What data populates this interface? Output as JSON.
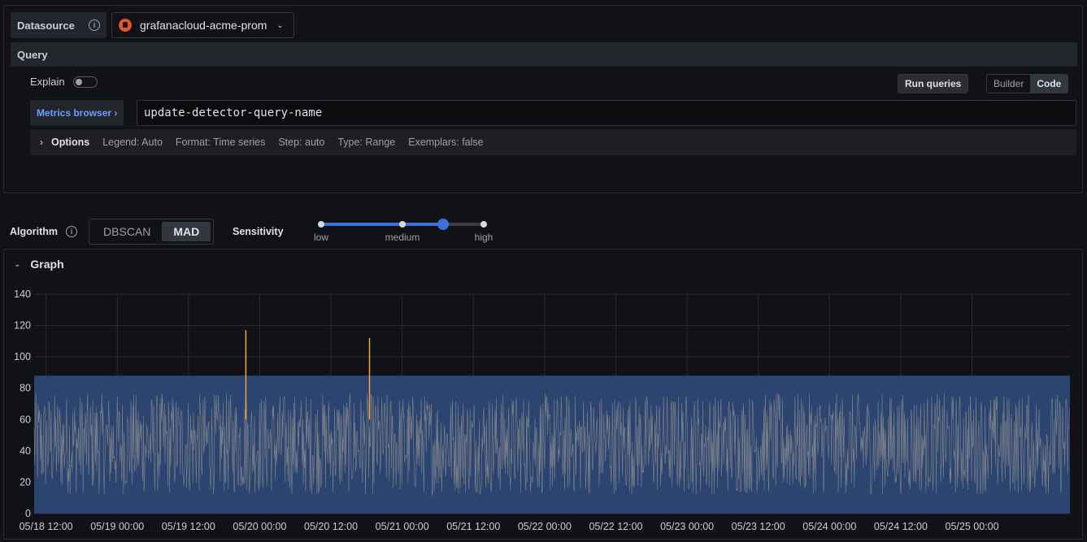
{
  "datasource": {
    "label": "Datasource",
    "icon": "prometheus-icon",
    "selected": "grafanacloud-acme-prom"
  },
  "query": {
    "section_label": "Query",
    "explain_label": "Explain",
    "explain_enabled": false,
    "run_label": "Run queries",
    "modes": [
      "Builder",
      "Code"
    ],
    "active_mode": "Code",
    "metrics_browser_label": "Metrics browser ›",
    "expression": "update-detector-query-name",
    "options": {
      "title": "Options",
      "items": [
        "Legend: Auto",
        "Format: Time series",
        "Step: auto",
        "Type: Range",
        "Exemplars: false"
      ]
    }
  },
  "algorithm": {
    "label": "Algorithm",
    "options": [
      "DBSCAN",
      "MAD"
    ],
    "selected": "MAD"
  },
  "sensitivity": {
    "label": "Sensitivity",
    "ticks": [
      "low",
      "medium",
      "high"
    ],
    "value_fraction": 0.75
  },
  "graph": {
    "title": "Graph"
  },
  "colors": {
    "series": "#8e8e8e",
    "band": "#2c4470",
    "anomaly": "#f2a73b",
    "accent": "#3d71d9"
  },
  "chart_data": {
    "type": "line",
    "title": "",
    "xlabel": "",
    "ylabel": "",
    "ylim": [
      0,
      140
    ],
    "yticks": [
      0,
      20,
      40,
      60,
      80,
      100,
      120,
      140
    ],
    "xticks": [
      "05/18 12:00",
      "05/19 00:00",
      "05/19 12:00",
      "05/20 00:00",
      "05/20 12:00",
      "05/21 00:00",
      "05/21 12:00",
      "05/22 00:00",
      "05/22 12:00",
      "05/23 00:00",
      "05/23 12:00",
      "05/24 00:00",
      "05/24 12:00",
      "05/25 00:00"
    ],
    "x_range": [
      "05/18 10:00",
      "05/25 16:30"
    ],
    "band": {
      "lower": 0,
      "upper": 88
    },
    "series_range": {
      "min": 12,
      "max": 77
    },
    "anomalies": [
      {
        "x": "05/19 21:40",
        "value": 117
      },
      {
        "x": "05/20 18:30",
        "value": 112
      }
    ],
    "grid": true,
    "legend": "none"
  }
}
